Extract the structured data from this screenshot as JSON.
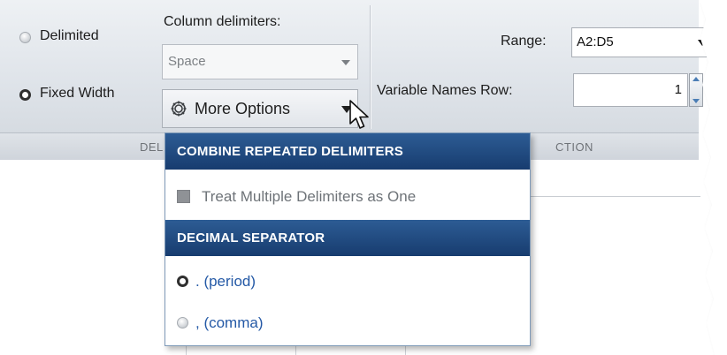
{
  "toolstrip": {
    "delimited_label": "Delimited",
    "fixed_width_label": "Fixed Width",
    "column_delimiters_label": "Column delimiters:",
    "column_delimiters_value": "Space",
    "more_options_label": "More Options",
    "range_label": "Range:",
    "range_value": "A2:D5",
    "variable_names_row_label": "Variable Names Row:",
    "variable_names_row_value": "1",
    "section_label_left": "DEL",
    "section_label_right": "CTION"
  },
  "more_options_menu": {
    "combine_header": "COMBINE REPEATED DELIMITERS",
    "treat_multiple_label": "Treat Multiple Delimiters as One",
    "treat_multiple_checked": false,
    "decimal_header": "DECIMAL SEPARATOR",
    "period_label": ". (period)",
    "comma_label": ", (comma)",
    "selected_separator": "period"
  },
  "colors": {
    "menu_header_bg": "#1f4a80",
    "option_text": "#2459a6",
    "disabled_text": "#6e7378"
  },
  "icons": {
    "more_options": "gear-icon",
    "dropdown": "chevron-down-icon",
    "cursor": "mouse-pointer-icon"
  }
}
